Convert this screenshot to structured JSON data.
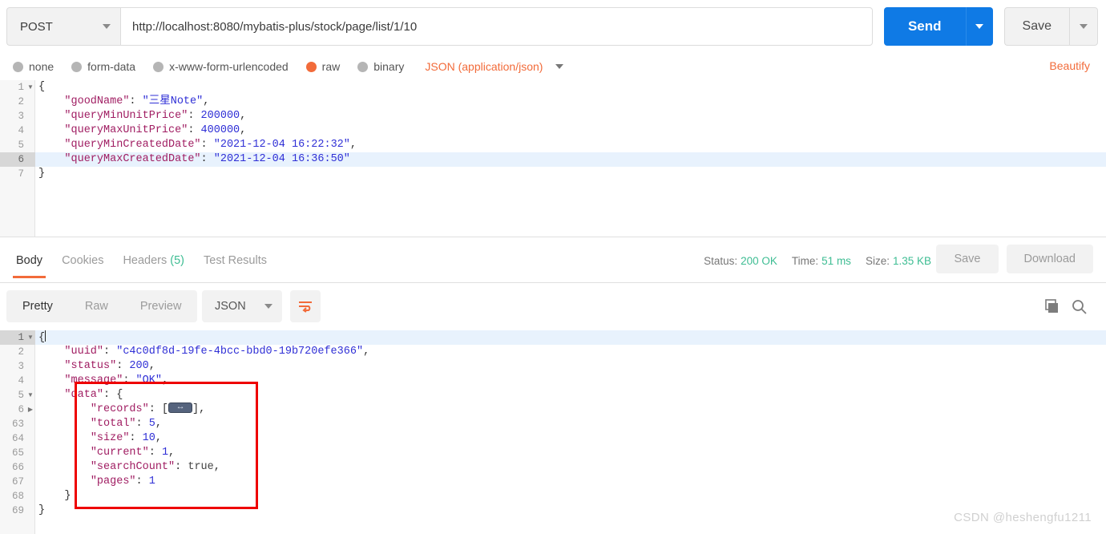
{
  "request": {
    "method": "POST",
    "url": "http://localhost:8080/mybatis-plus/stock/page/list/1/10",
    "send_label": "Send",
    "save_label": "Save",
    "beautify_label": "Beautify",
    "body_types": [
      {
        "label": "none",
        "selected": false
      },
      {
        "label": "form-data",
        "selected": false
      },
      {
        "label": "x-www-form-urlencoded",
        "selected": false
      },
      {
        "label": "raw",
        "selected": true
      },
      {
        "label": "binary",
        "selected": false
      }
    ],
    "content_type": "JSON (application/json)",
    "body_lines": [
      {
        "num": "1",
        "fold": "open",
        "active": false,
        "text": "{"
      },
      {
        "num": "2",
        "fold": "",
        "active": false,
        "text": "    \"goodName\": \"三星Note\","
      },
      {
        "num": "3",
        "fold": "",
        "active": false,
        "text": "    \"queryMinUnitPrice\": 200000,"
      },
      {
        "num": "4",
        "fold": "",
        "active": false,
        "text": "    \"queryMaxUnitPrice\": 400000,"
      },
      {
        "num": "5",
        "fold": "",
        "active": false,
        "text": "    \"queryMinCreatedDate\": \"2021-12-04 16:22:32\","
      },
      {
        "num": "6",
        "fold": "",
        "active": true,
        "text": "    \"queryMaxCreatedDate\": \"2021-12-04 16:36:50\""
      },
      {
        "num": "7",
        "fold": "",
        "active": false,
        "text": "}"
      }
    ]
  },
  "response": {
    "tabs": [
      {
        "label": "Body",
        "active": true,
        "count": ""
      },
      {
        "label": "Cookies",
        "active": false,
        "count": ""
      },
      {
        "label": "Headers",
        "active": false,
        "count": "(5)"
      },
      {
        "label": "Test Results",
        "active": false,
        "count": ""
      }
    ],
    "status_label": "Status:",
    "status_value": "200 OK",
    "time_label": "Time:",
    "time_value": "51 ms",
    "size_label": "Size:",
    "size_value": "1.35 KB",
    "save_label": "Save",
    "download_label": "Download",
    "view_modes": [
      {
        "label": "Pretty",
        "active": true
      },
      {
        "label": "Raw",
        "active": false
      },
      {
        "label": "Preview",
        "active": false
      }
    ],
    "format": "JSON",
    "body_lines": [
      {
        "num": "1",
        "fold": "open",
        "active": true,
        "text": "{",
        "cursor": true
      },
      {
        "num": "2",
        "fold": "",
        "active": false,
        "text": "    \"uuid\": \"c4c0df8d-19fe-4bcc-bbd0-19b720efe366\","
      },
      {
        "num": "3",
        "fold": "",
        "active": false,
        "text": "    \"status\": 200,"
      },
      {
        "num": "4",
        "fold": "",
        "active": false,
        "text": "    \"message\": \"OK\","
      },
      {
        "num": "5",
        "fold": "open",
        "active": false,
        "text": "    \"data\": {"
      },
      {
        "num": "6",
        "fold": "collapsed",
        "active": false,
        "text": "        \"records\": [",
        "badge": true,
        "text_after": "],"
      },
      {
        "num": "63",
        "fold": "",
        "active": false,
        "text": "        \"total\": 5,"
      },
      {
        "num": "64",
        "fold": "",
        "active": false,
        "text": "        \"size\": 10,"
      },
      {
        "num": "65",
        "fold": "",
        "active": false,
        "text": "        \"current\": 1,"
      },
      {
        "num": "66",
        "fold": "",
        "active": false,
        "text": "        \"searchCount\": true,"
      },
      {
        "num": "67",
        "fold": "",
        "active": false,
        "text": "        \"pages\": 1"
      },
      {
        "num": "68",
        "fold": "",
        "active": false,
        "text": "    }"
      },
      {
        "num": "69",
        "fold": "",
        "active": false,
        "text": "}"
      }
    ]
  },
  "annotation": {
    "highlight_color": "#ee0000"
  },
  "watermark": "CSDN @heshengfu1211"
}
